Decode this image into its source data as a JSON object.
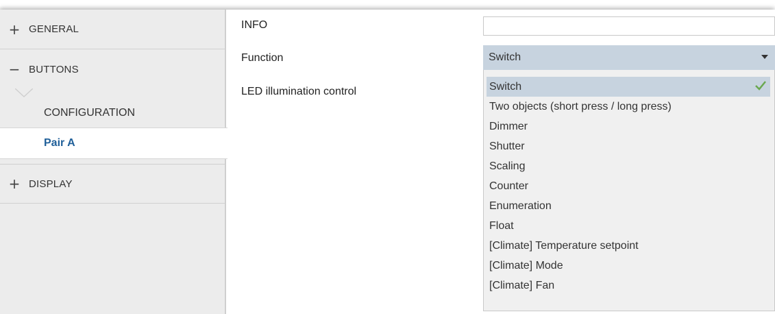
{
  "sidebar": {
    "groups": [
      {
        "sign": "+",
        "label": "GENERAL"
      },
      {
        "sign": "−",
        "label": "BUTTONS"
      },
      {
        "sign": "+",
        "label": "DISPLAY"
      }
    ],
    "sub_items": [
      {
        "label": "CONFIGURATION"
      },
      {
        "label": "Pair A"
      }
    ]
  },
  "main": {
    "info": {
      "label": "INFO",
      "value": ""
    },
    "function": {
      "label": "Function",
      "selected": "Switch"
    },
    "led": {
      "label": "LED illumination control"
    },
    "dropdown_options": [
      "Switch",
      "Two objects (short press / long press)",
      "Dimmer",
      "Shutter",
      "Scaling",
      "Counter",
      "Enumeration",
      "Float",
      "[Climate] Temperature setpoint",
      "[Climate] Mode",
      "[Climate] Fan"
    ]
  },
  "colors": {
    "active_text": "#1f5f99",
    "select_bg": "#c7d3df",
    "check": "#6aa84f"
  }
}
